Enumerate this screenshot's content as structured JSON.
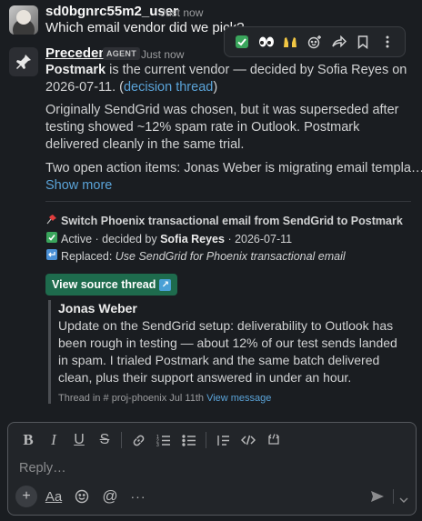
{
  "user_message": {
    "author": "sd0bgnrc55m2_user",
    "timestamp": "Just now",
    "text": "Which email vendor did we pick?"
  },
  "hover_toolbar": {
    "icons": [
      "check-mark-icon",
      "eyes-icon",
      "raised-hands-icon",
      "add-reaction-icon",
      "share-icon",
      "bookmark-icon",
      "more-actions-icon"
    ]
  },
  "agent_message": {
    "author": "Precedent",
    "badge": "AGENT",
    "timestamp": "Just now",
    "p1_vendor": "Postmark",
    "p1_mid": " is the current vendor — decided by Sofia Reyes on 2026-07-11. (",
    "p1_link": "decision thread",
    "p1_end": ")",
    "p2": "Originally SendGrid was chosen, but it was superseded after testing showed ~12% spam rate in Outlook. Postmark delivered cleanly in the same trial.",
    "p3": "Two open action items: Jonas Weber is migrating email templates t...",
    "show_more": "Show more",
    "decision": {
      "title": "Switch Phoenix transactional email from SendGrid to Postmark",
      "status_prefix": "Active · decided by ",
      "decider": "Sofia Reyes",
      "date_suffix": " · 2026-07-11",
      "replaced_prefix": "Replaced: ",
      "replaced_text": "Use SendGrid for Phoenix transactional email"
    },
    "source_button": "View source thread",
    "quote": {
      "author": "Jonas Weber",
      "text": "Update on the SendGrid setup: deliverability to Outlook has been rough in testing — about 12% of our test sends landed in spam. I trialed Postmark and the same batch delivered clean, plus their support answered in under an hour.",
      "meta_prefix": "Thread in # proj-phoenix  Jul 11th  ",
      "meta_link": "View message"
    }
  },
  "composer": {
    "placeholder": "Reply…"
  }
}
